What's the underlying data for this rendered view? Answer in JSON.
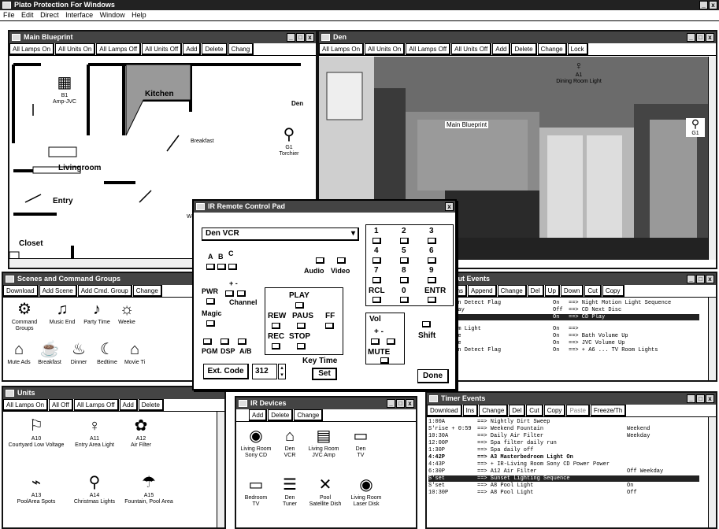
{
  "app": {
    "title": "Plato Protection For Windows"
  },
  "menu": [
    "File",
    "Edit",
    "Direct",
    "Interface",
    "Window",
    "Help"
  ],
  "blueprint": {
    "title": "Main Blueprint",
    "buttons": [
      "All Lamps On",
      "All Units On",
      "All Lamps Off",
      "All Units Off",
      "Add",
      "Delete",
      "Chang"
    ],
    "rooms": {
      "kitchen": "Kitchen",
      "livingroom": "Livingroom",
      "entry": "Entry",
      "closet": "Closet",
      "den": "Den",
      "breakfast": "Breakfast",
      "weekend": "Weekend"
    },
    "units": [
      {
        "code": "B1",
        "name": "Amp-JVC"
      },
      {
        "code": "G1",
        "name": "Torchier"
      }
    ]
  },
  "den": {
    "title": "Den",
    "buttons": [
      "All Lamps On",
      "All Units On",
      "All Lamps Off",
      "All Units Off",
      "Add",
      "Delete",
      "Change",
      "Lock"
    ],
    "light": {
      "code": "A1",
      "name": "Dining Room Light"
    },
    "g1": "G1",
    "label": "Main Blueprint"
  },
  "scenes": {
    "title": "Scenes and Command Groups",
    "buttons": [
      "Download",
      "Add Scene",
      "Add Cmd. Group",
      "Change"
    ],
    "items": [
      "Command Groups",
      "Music End",
      "Party Time",
      "Weeke",
      "Mute Ads",
      "Breakfast",
      "Dinner",
      "Bedtime",
      "Movie Ti"
    ]
  },
  "remote": {
    "title": "IR Remote Control Pad",
    "device": "Den VCR",
    "abc": [
      "A",
      "B",
      "C"
    ],
    "labels": {
      "audio": "Audio",
      "video": "Video",
      "pwr": "PWR",
      "plusminus": "+ -",
      "channel": "Channel",
      "magic": "Magic",
      "pgm": "PGM",
      "dsp": "DSP",
      "ab": "A/B",
      "play": "PLAY",
      "rew": "REW",
      "paus": "PAUS",
      "ff": "FF",
      "rec": "REC",
      "stop": "STOP",
      "vol": "Vol",
      "volpm": "+ -",
      "mute": "MUTE",
      "shift": "Shift",
      "rcl": "RCL",
      "zero": "0",
      "entr": "ENTR",
      "keytime": "Key Time"
    },
    "digits": [
      "1",
      "2",
      "3",
      "4",
      "5",
      "6",
      "7",
      "8",
      "9"
    ],
    "ext_code_label": "Ext. Code",
    "ext_code_value": "312",
    "set": "Set",
    "done": "Done"
  },
  "input_events": {
    "title": "Input Events",
    "buttons": [
      "oad",
      "Ins",
      "Append",
      "Change",
      "Del",
      "Up",
      "Down",
      "Cut",
      "Copy"
    ],
    "rows": [
      {
        "name": "t Motion Detect Flag",
        "state": "On",
        "action": "==> Night Motion Light Sequence"
      },
      {
        "name": "Stop/Play",
        "state": "Off",
        "action": "==> CD Next Disc"
      },
      {
        "name": "VCD",
        "state": "On",
        "action": "==> CD Play"
      },
      {
        "name": "ing Room Light",
        "state": "On",
        "action": "==>"
      },
      {
        "name": "n Volume",
        "state": "On",
        "action": "==> Bath Volume Up"
      },
      {
        "name": "n Volume",
        "state": "On",
        "action": "==> JVC Volume Up"
      },
      {
        "name": "t Motion Detect Flag",
        "state": "On",
        "action": "==> + A6 ... TV Room Lights"
      }
    ]
  },
  "units": {
    "title": "Units",
    "buttons": [
      "All Lamps On",
      "All Off",
      "All Lamps Off",
      "Add",
      "Delete"
    ],
    "items": [
      {
        "code": "A10",
        "name": "Courtyard Low Voltage"
      },
      {
        "code": "A11",
        "name": "Entry Area Light"
      },
      {
        "code": "A12",
        "name": "Air Filter"
      },
      {
        "code": "A13",
        "name": "PoolArea Spots"
      },
      {
        "code": "A14",
        "name": "Christmas Lights"
      },
      {
        "code": "A15",
        "name": "Fountain, Pool Area"
      }
    ]
  },
  "ir_devices": {
    "title": "IR Devices",
    "buttons": [
      "Add",
      "Delete",
      "Change"
    ],
    "items": [
      {
        "line1": "Living Room",
        "line2": "Sony CD"
      },
      {
        "line1": "Den",
        "line2": "VCR"
      },
      {
        "line1": "Living Room",
        "line2": "JVC Amp"
      },
      {
        "line1": "Den",
        "line2": "TV"
      },
      {
        "line1": "Bedroom",
        "line2": "TV"
      },
      {
        "line1": "Den",
        "line2": "Tuner"
      },
      {
        "line1": "Pool",
        "line2": "Satellite Dish"
      },
      {
        "line1": "Living Room",
        "line2": "Laser Disk"
      }
    ]
  },
  "timer_events": {
    "title": "Timer Events",
    "buttons": [
      "Download",
      "Ins",
      "Change",
      "Del",
      "Cut",
      "Copy",
      "Paste",
      "Freeze/Th"
    ],
    "rows": [
      {
        "time": "1:00A",
        "action": "==> Nightly Dirt Sweep",
        "extra": ""
      },
      {
        "time": "S'rise + 0:59",
        "action": "==> Weekend Fountain",
        "extra": "Weekend"
      },
      {
        "time": "10:30A",
        "action": "==> Daily Air Filter",
        "extra": "Weekday"
      },
      {
        "time": "12:00P",
        "action": "==> Spa filter daily run",
        "extra": ""
      },
      {
        "time": "1:30P",
        "action": "==> Spa daily off",
        "extra": ""
      },
      {
        "time": "4:42P",
        "action": "==> A3  Masterbedroom Light On",
        "extra": ""
      },
      {
        "time": "4:43P",
        "action": "==> + IR-Living Room Sony CD Power Power",
        "extra": ""
      },
      {
        "time": "6:30P",
        "action": "==> A12  Air Filter",
        "extra": "Off     Weekday"
      },
      {
        "time": "S'set",
        "action": "==> Sunset Lighting Sequence",
        "extra": ""
      },
      {
        "time": "S'set",
        "action": "==> A8  Pool Light",
        "extra": "On"
      },
      {
        "time": "10:30P",
        "action": "==> A8  Pool Light",
        "extra": "Off"
      }
    ]
  }
}
